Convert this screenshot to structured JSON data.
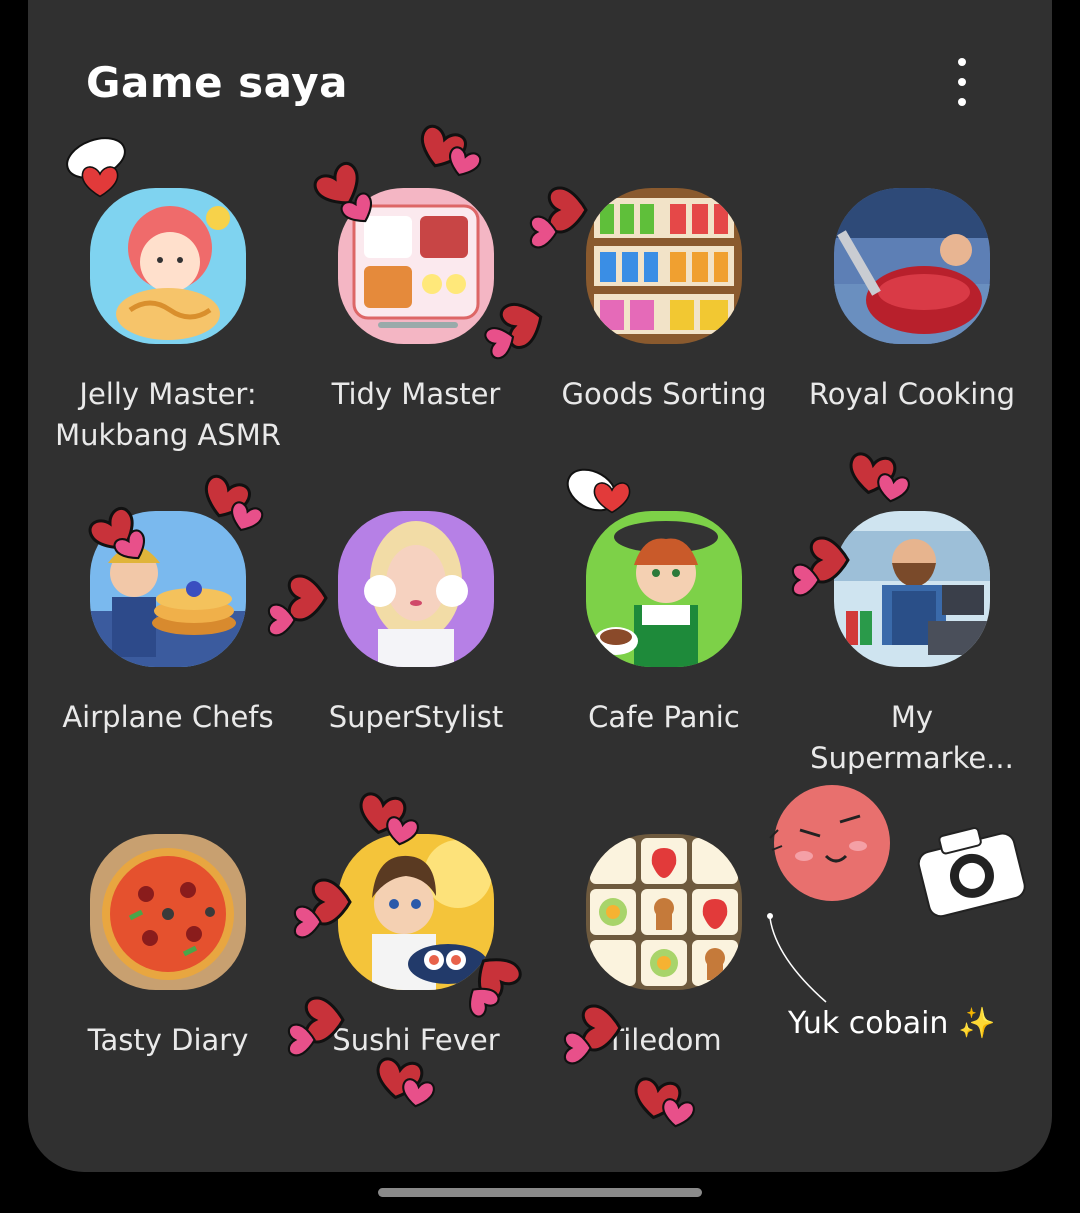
{
  "header": {
    "title": "Game saya",
    "more_icon": "more-vert-icon"
  },
  "apps": [
    {
      "label": "Jelly Master: Mukbang ASMR",
      "icon": "jelly-master-icon"
    },
    {
      "label": "Tidy Master",
      "icon": "tidy-master-icon"
    },
    {
      "label": "Goods Sorting",
      "icon": "goods-sorting-icon"
    },
    {
      "label": "Royal Cooking",
      "icon": "royal-cooking-icon"
    },
    {
      "label": "Airplane Chefs",
      "icon": "airplane-chefs-icon"
    },
    {
      "label": "SuperStylist",
      "icon": "superstylist-icon"
    },
    {
      "label": "Cafe Panic",
      "icon": "cafe-panic-icon"
    },
    {
      "label": "My Supermarke...",
      "icon": "my-supermarket-icon"
    },
    {
      "label": "Tasty Diary",
      "icon": "tasty-diary-icon"
    },
    {
      "label": "Sushi Fever",
      "icon": "sushi-fever-icon"
    },
    {
      "label": "Tiledom",
      "icon": "tiledom-icon"
    }
  ],
  "overlay": {
    "caption": "Yuk cobain",
    "sparkle": "✨",
    "camera_icon": "camera-icon",
    "face_sticker": "blush-face-sticker"
  },
  "colors": {
    "panel": "#303030",
    "background": "#000000",
    "heart": "#c8323a",
    "heart_pink": "#e8508a"
  }
}
